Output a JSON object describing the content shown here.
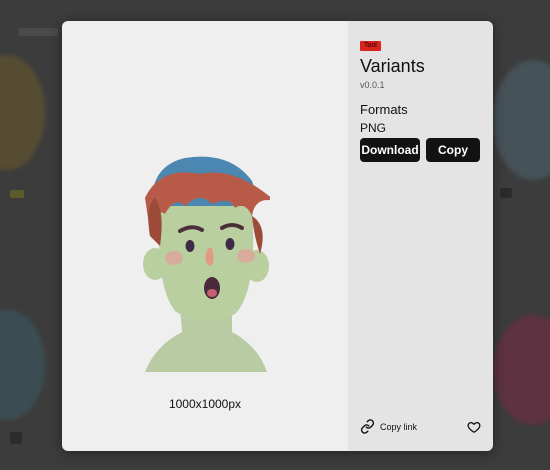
{
  "tool_tag": "Tool",
  "title": "Variants",
  "version": "v0.0.1",
  "formats": {
    "heading": "Formats",
    "items": [
      {
        "name": "PNG",
        "download_label": "Download",
        "copy_label": "Copy"
      }
    ]
  },
  "preview": {
    "dimensions": "1000x1000px"
  },
  "footer": {
    "copy_link_label": "Copy link"
  },
  "icons": {
    "link": "link-icon",
    "favorite": "heart-icon"
  },
  "colors": {
    "tag": "#d9231d",
    "button": "#121212",
    "overlay": "#3c3c3c"
  }
}
